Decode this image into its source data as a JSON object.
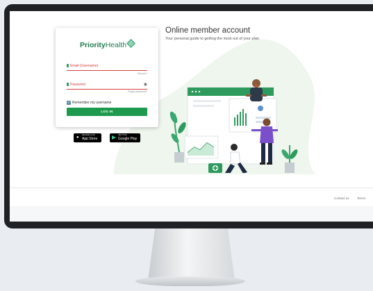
{
  "brand": {
    "name_bold": "Priority",
    "name_light": "Health"
  },
  "login": {
    "email_label": "Email (Username)",
    "not_you": "Not you?",
    "password_label": "Password",
    "forgot_password": "Forgot password?",
    "remember_label": "Remember my username",
    "remember_checked": true,
    "login_button": "LOG IN"
  },
  "badges": {
    "app_store_small": "Download on the",
    "app_store": "App Store",
    "google_play_small": "GET IT ON",
    "google_play": "Google Play"
  },
  "header": {
    "title": "Online member account",
    "subtitle": "Your personal guide to getting the most out of your plan."
  },
  "footer": {
    "contact": "Contact us",
    "terms": "Terms"
  },
  "colors": {
    "brand_green": "#1e9a4e",
    "error_red": "#d94040",
    "dark_frame": "#1f2124"
  },
  "icons": {
    "email": "person-icon",
    "password": "lock-icon",
    "show_password": "eye-icon",
    "checkbox": "checkmark-icon",
    "apple": "apple-icon",
    "google_play": "google-play-icon"
  }
}
